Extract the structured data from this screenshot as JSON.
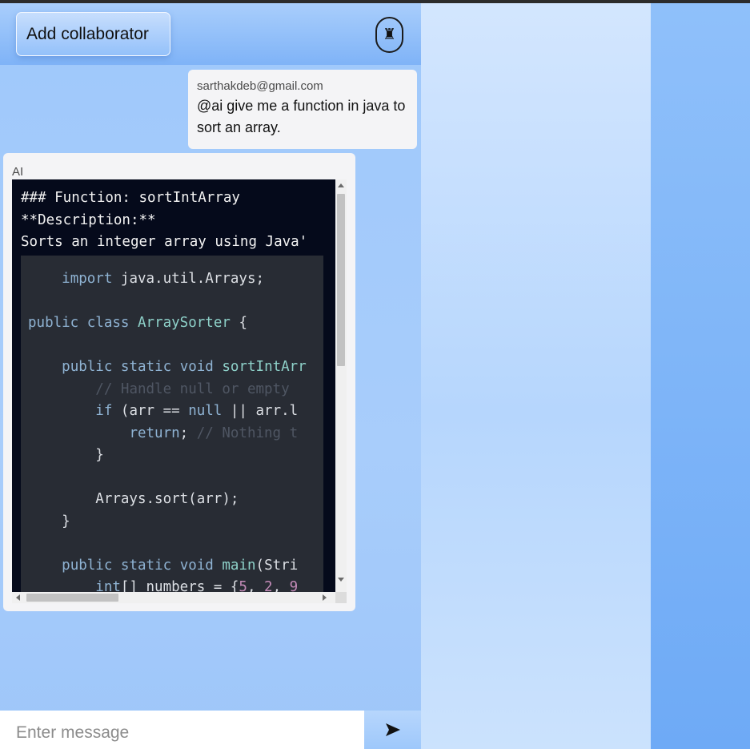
{
  "header": {
    "add_collaborator_label": "Add collaborator",
    "rook_icon": "chess-rook-icon",
    "rook_glyph": "♜"
  },
  "messages": [
    {
      "sender": "sarthakdeb@gmail.com",
      "text": "@ai give me a function in java to sort an array."
    },
    {
      "sender": "AI",
      "markdown_lines": [
        "### Function: sortIntArray",
        "**Description:**",
        "Sorts an integer array using Java'"
      ],
      "code_lines": [
        "    import java.util.Arrays;",
        "",
        "public class ArraySorter {",
        "",
        "    public static void sortIntArr",
        "        // Handle null or empty ",
        "        if (arr == null || arr.l",
        "            return; // Nothing t",
        "        }",
        "",
        "        Arrays.sort(arr);",
        "    }",
        "",
        "    public static void main(Stri",
        "        int[] numbers = {5, 2, 9"
      ]
    }
  ],
  "input": {
    "placeholder": "Enter message",
    "send_icon": "send-arrow-icon"
  },
  "colors": {
    "code_background": "#050a1b",
    "code_block_background": "#282c34",
    "keyword": "#8fb3d3",
    "function_name": "#8ed1c9",
    "comment": "#4f5663",
    "number": "#c48bb8"
  }
}
